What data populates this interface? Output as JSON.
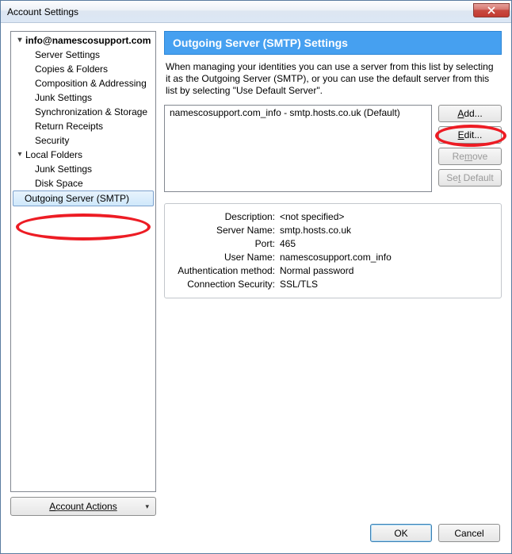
{
  "window": {
    "title": "Account Settings"
  },
  "tree": {
    "account": "info@namescosupport.com",
    "items": [
      "Server Settings",
      "Copies & Folders",
      "Composition & Addressing",
      "Junk Settings",
      "Synchronization & Storage",
      "Return Receipts",
      "Security"
    ],
    "localFolders": "Local Folders",
    "localItems": [
      "Junk Settings",
      "Disk Space"
    ],
    "outgoing": "Outgoing Server (SMTP)"
  },
  "accountActionsLabel": "Account Actions",
  "panel": {
    "heading": "Outgoing Server (SMTP) Settings",
    "intro": "When managing your identities you can use a server from this list by selecting it as the Outgoing Server (SMTP), or you can use the default server from this list by selecting \"Use Default Server\".",
    "listItem": "namescosupport.com_info - smtp.hosts.co.uk (Default)"
  },
  "buttons": {
    "add": "Add...",
    "edit": "Edit...",
    "remove": "Remove",
    "setDefault": "Set Default",
    "ok": "OK",
    "cancel": "Cancel"
  },
  "details": {
    "labels": {
      "description": "Description:",
      "serverName": "Server Name:",
      "port": "Port:",
      "userName": "User Name:",
      "authMethod": "Authentication method:",
      "connSec": "Connection Security:"
    },
    "values": {
      "description": "<not specified>",
      "serverName": "smtp.hosts.co.uk",
      "port": "465",
      "userName": "namescosupport.com_info",
      "authMethod": "Normal password",
      "connSec": "SSL/TLS"
    }
  }
}
